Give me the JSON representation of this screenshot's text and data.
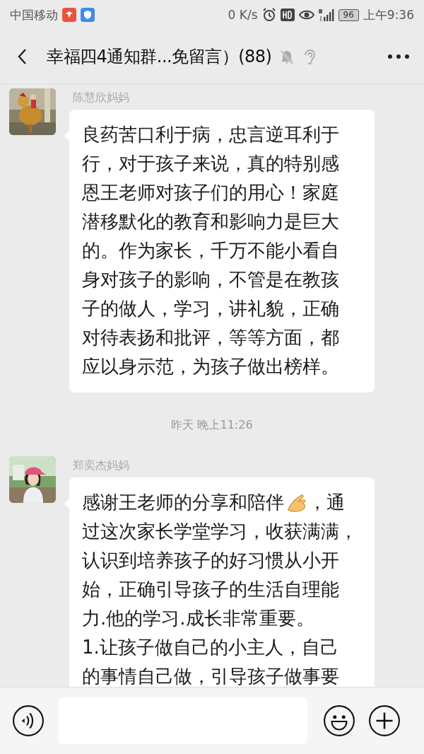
{
  "status_bar": {
    "carrier": "中国移动",
    "speed": "0 K/s",
    "battery": "96",
    "time": "上午9:36"
  },
  "header": {
    "title": "幸福四4通知群...免留言）(88)",
    "muted": true,
    "earpiece": true
  },
  "messages": [
    {
      "kind": "message",
      "sender": "陈慧欣妈妈",
      "lines": [
        [
          {
            "kind": "text",
            "text": "良药苦口利于病，忠言逆耳利于"
          }
        ],
        [
          {
            "kind": "text",
            "text": "行，对于孩子来说，真的特别感"
          }
        ],
        [
          {
            "kind": "text",
            "text": "恩王老师对孩子们的用心！家庭"
          }
        ],
        [
          {
            "kind": "text",
            "text": "潜移默化的教育和影响力是巨大"
          }
        ],
        [
          {
            "kind": "text",
            "text": "的。作为家长，千万不能小看自"
          }
        ],
        [
          {
            "kind": "text",
            "text": "身对孩子的影响，不管是在教孩"
          }
        ],
        [
          {
            "kind": "text",
            "text": "子的做人，学习，讲礼貌，正确"
          }
        ],
        [
          {
            "kind": "text",
            "text": "对待表扬和批评，等等方面，都"
          }
        ],
        [
          {
            "kind": "text",
            "text": "应以身示范，为孩子做出榜样。"
          }
        ]
      ]
    },
    {
      "kind": "time",
      "text": "昨天 晚上11:26"
    },
    {
      "kind": "message",
      "sender": "郑奕杰妈妈",
      "lines": [
        [
          {
            "kind": "text",
            "text": "感谢王老师的分享和陪伴"
          },
          {
            "kind": "emoji"
          },
          {
            "kind": "text",
            "text": "，通"
          }
        ],
        [
          {
            "kind": "text",
            "text": "过这次家长学堂学习，收获满满，"
          }
        ],
        [
          {
            "kind": "text",
            "text": "认识到培养孩子的好习惯从小开"
          }
        ],
        [
          {
            "kind": "text",
            "text": "始，正确引导孩子的生活自理能"
          }
        ],
        [
          {
            "kind": "text",
            "text": "力.他的学习.成长非常重要。"
          }
        ],
        [
          {
            "kind": "text",
            "text": "1.让孩子做自己的小主人，自己"
          }
        ],
        [
          {
            "kind": "text",
            "text": "的事情自己做，引导孩子做事要"
          }
        ]
      ]
    }
  ]
}
